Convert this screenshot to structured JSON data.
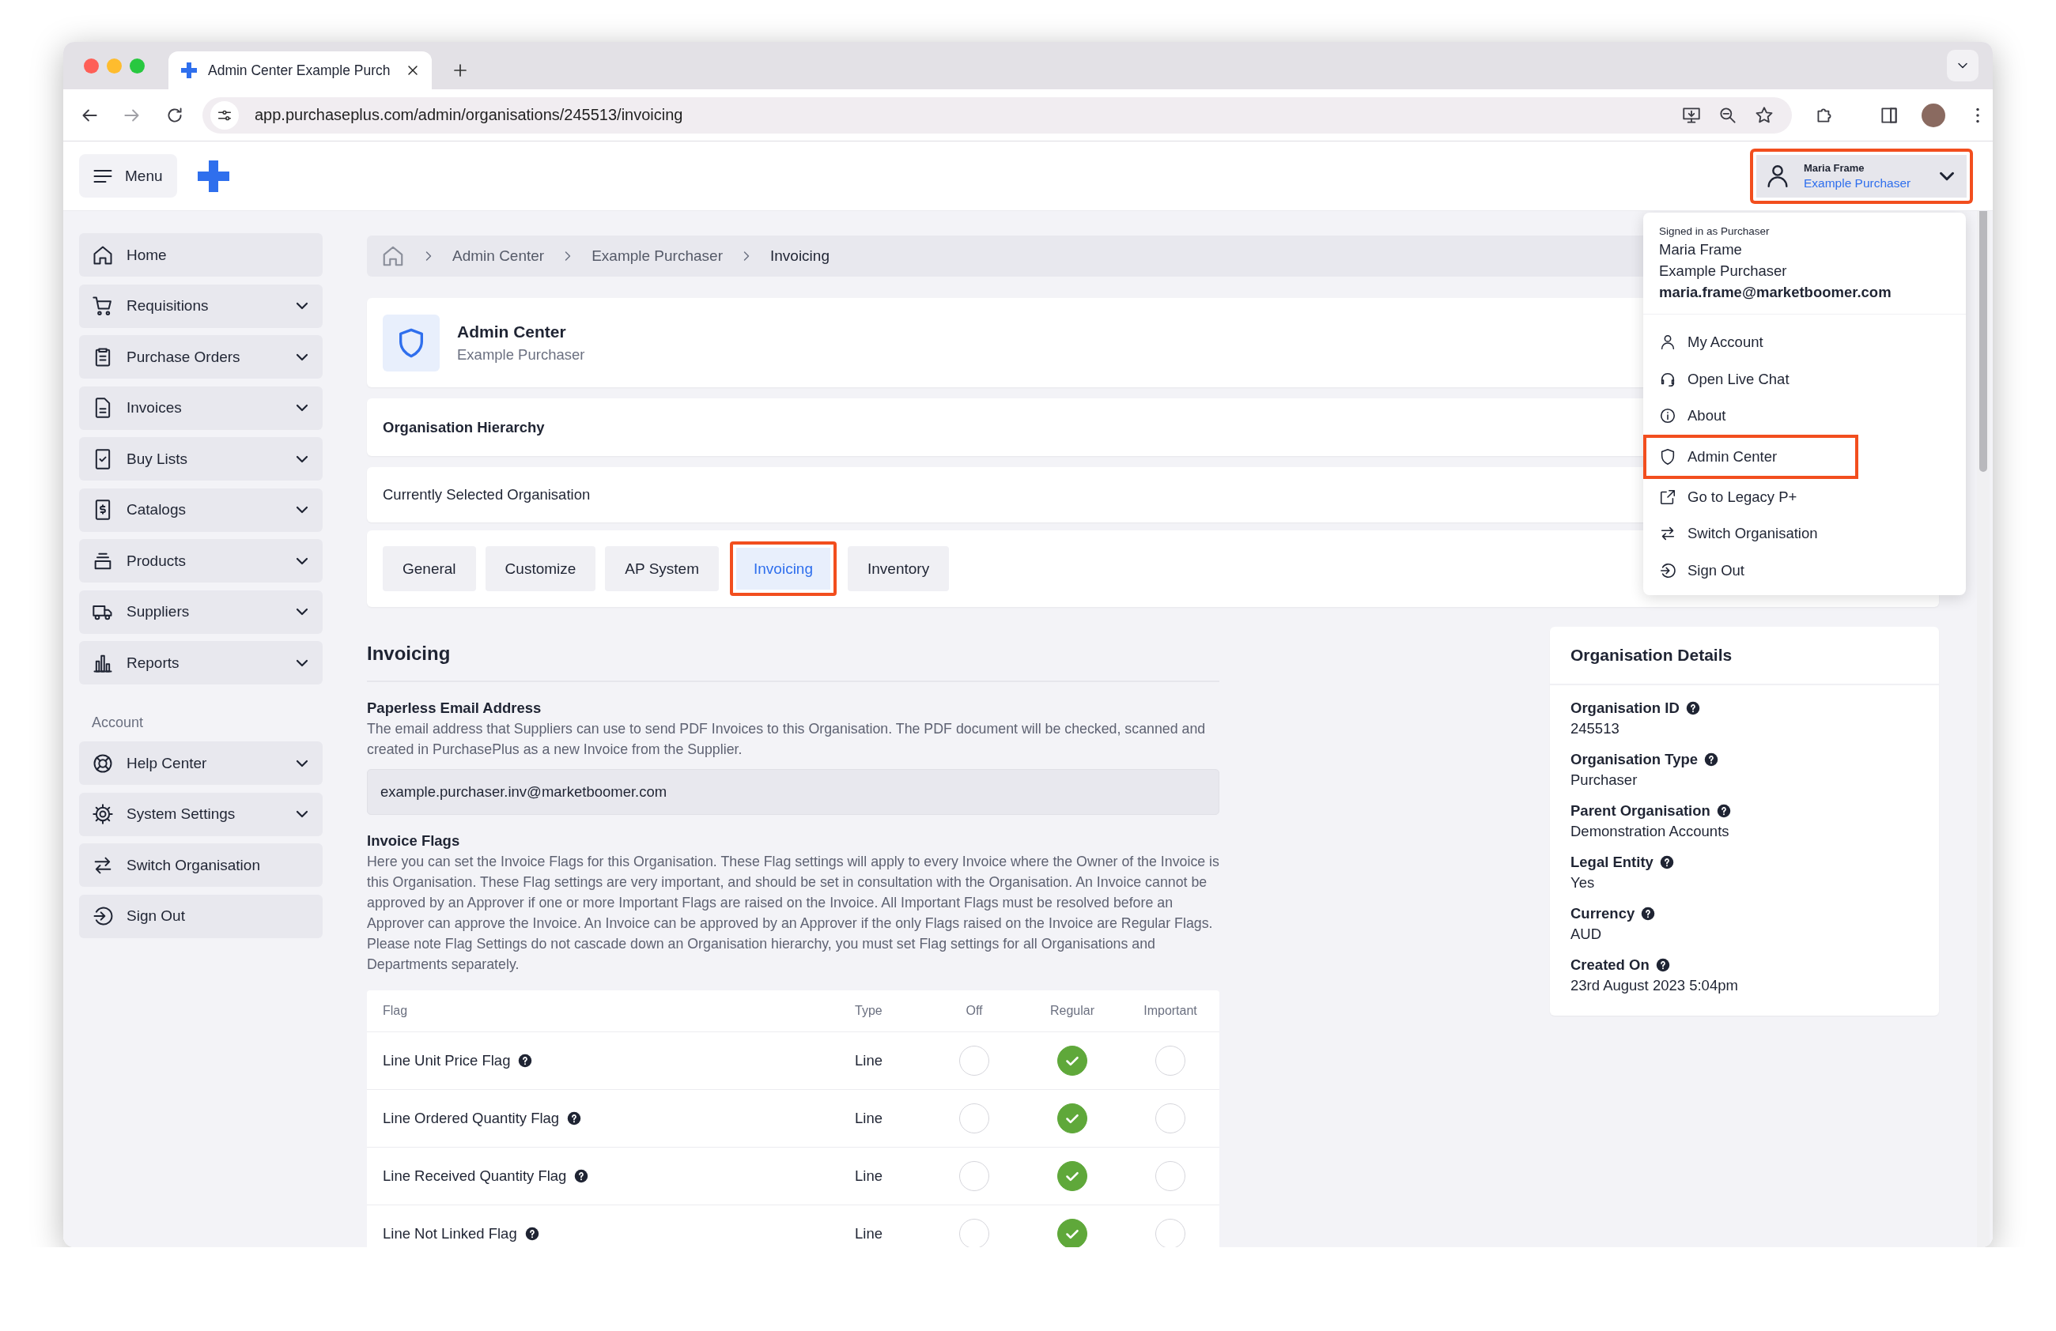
{
  "browser": {
    "tab_title": "Admin Center Example Purch",
    "url": "app.purchaseplus.com/admin/organisations/245513/invoicing"
  },
  "header": {
    "menu_label": "Menu",
    "user": {
      "name": "Maria Frame",
      "organisation": "Example Purchaser",
      "highlighted": true
    }
  },
  "user_menu": {
    "signed_in_as": "Signed in as Purchaser",
    "name": "Maria Frame",
    "organisation": "Example Purchaser",
    "email": "maria.frame@marketboomer.com",
    "items": [
      {
        "label": "My Account",
        "highlighted": false
      },
      {
        "label": "Open Live Chat",
        "highlighted": false
      },
      {
        "label": "About",
        "highlighted": false
      },
      {
        "label": "Admin Center",
        "highlighted": true
      },
      {
        "label": "Go to Legacy P+",
        "highlighted": false
      },
      {
        "label": "Switch Organisation",
        "highlighted": false
      },
      {
        "label": "Sign Out",
        "highlighted": false
      }
    ]
  },
  "sidebar": {
    "items": [
      {
        "label": "Home",
        "expandable": false
      },
      {
        "label": "Requisitions",
        "expandable": true
      },
      {
        "label": "Purchase Orders",
        "expandable": true
      },
      {
        "label": "Invoices",
        "expandable": true
      },
      {
        "label": "Buy Lists",
        "expandable": true
      },
      {
        "label": "Catalogs",
        "expandable": true
      },
      {
        "label": "Products",
        "expandable": true
      },
      {
        "label": "Suppliers",
        "expandable": true
      },
      {
        "label": "Reports",
        "expandable": true
      }
    ],
    "section_label": "Account",
    "account_items": [
      {
        "label": "Help Center",
        "expandable": true
      },
      {
        "label": "System Settings",
        "expandable": true
      },
      {
        "label": "Switch Organisation",
        "expandable": false
      },
      {
        "label": "Sign Out",
        "expandable": false
      }
    ]
  },
  "breadcrumb": [
    "Admin Center",
    "Example Purchaser",
    "Invoicing"
  ],
  "page_header": {
    "title": "Admin Center",
    "subtitle": "Example Purchaser"
  },
  "panels": [
    {
      "label": "Organisation Hierarchy",
      "bold": true
    },
    {
      "label": "Currently Selected Organisation",
      "bold": false
    }
  ],
  "tabs": [
    {
      "label": "General",
      "selected": false,
      "highlighted": false
    },
    {
      "label": "Customize",
      "selected": false,
      "highlighted": false
    },
    {
      "label": "AP System",
      "selected": false,
      "highlighted": false
    },
    {
      "label": "Invoicing",
      "selected": true,
      "highlighted": true
    },
    {
      "label": "Inventory",
      "selected": false,
      "highlighted": false
    }
  ],
  "invoicing": {
    "title": "Invoicing",
    "email_section": {
      "title": "Paperless Email Address",
      "description": "The email address that Suppliers can use to send PDF Invoices to this Organisation. The PDF document will be checked, scanned and created in PurchasePlus as a new Invoice from the Supplier.",
      "value": "example.purchaser.inv@marketboomer.com"
    },
    "flags_section": {
      "title": "Invoice Flags",
      "description": "Here you can set the Invoice Flags for this Organisation. These Flag settings will apply to every Invoice where the Owner of the Invoice is this Organisation. These Flag settings are very important, and should be set in consultation with the Organisation. An Invoice cannot be approved by an Approver if one or more Important Flags are raised on the Invoice. All Important Flags must be resolved before an Approver can approve the Invoice. An Invoice can be approved by an Approver if the only Flags raised on the Invoice are Regular Flags. Please note Flag Settings do not cascade down an Organisation hierarchy, you must set Flag settings for all Organisations and Departments separately."
    },
    "table": {
      "columns": [
        "Flag",
        "Type",
        "Off",
        "Regular",
        "Important"
      ],
      "rows": [
        {
          "flag": "Line Unit Price Flag",
          "type": "Line",
          "off": false,
          "regular": true,
          "important": false
        },
        {
          "flag": "Line Ordered Quantity Flag",
          "type": "Line",
          "off": false,
          "regular": true,
          "important": false
        },
        {
          "flag": "Line Received Quantity Flag",
          "type": "Line",
          "off": false,
          "regular": true,
          "important": false
        },
        {
          "flag": "Line Not Linked Flag",
          "type": "Line",
          "off": false,
          "regular": true,
          "important": false
        }
      ]
    }
  },
  "details": {
    "title": "Organisation Details",
    "fields": [
      {
        "label": "Organisation ID",
        "value": "245513"
      },
      {
        "label": "Organisation Type",
        "value": "Purchaser"
      },
      {
        "label": "Parent Organisation",
        "value": "Demonstration Accounts"
      },
      {
        "label": "Legal Entity",
        "value": "Yes"
      },
      {
        "label": "Currency",
        "value": "AUD"
      },
      {
        "label": "Created On",
        "value": "23rd August 2023 5:04pm"
      }
    ]
  }
}
